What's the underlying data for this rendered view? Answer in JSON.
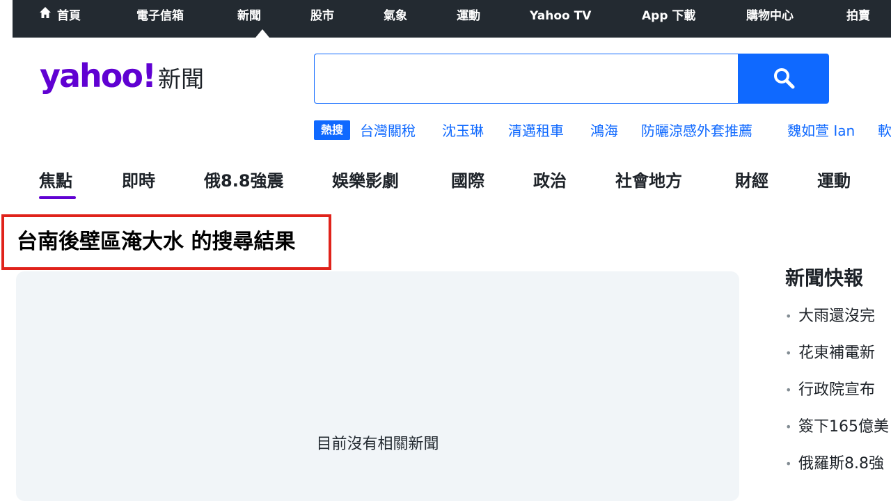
{
  "topnav": {
    "items": [
      {
        "label": "首頁",
        "icon": "home-icon"
      },
      {
        "label": "電子信箱"
      },
      {
        "label": "新聞",
        "active": true
      },
      {
        "label": "股市"
      },
      {
        "label": "氣象"
      },
      {
        "label": "運動"
      },
      {
        "label": "Yahoo TV"
      },
      {
        "label": "App 下載"
      },
      {
        "label": "購物中心"
      },
      {
        "label": "拍賣"
      }
    ]
  },
  "logo": {
    "brand": "yahoo!",
    "suffix": "新聞"
  },
  "search": {
    "value": "",
    "placeholder": "",
    "icon": "search-icon"
  },
  "trending": {
    "badge": "熱搜",
    "links": [
      "台灣關稅",
      "沈玉琳",
      "清邁租車",
      "鴻海",
      "防曬涼感外套推薦",
      "魏如萱 Ian",
      "軟"
    ]
  },
  "tabs": {
    "items": [
      "焦點",
      "即時",
      "俄8.8強震",
      "娛樂影劇",
      "國際",
      "政治",
      "社會地方",
      "財經",
      "運動"
    ],
    "active": "焦點"
  },
  "results": {
    "heading": "台南後壁區淹大水 的搜尋結果",
    "empty_message": "目前沒有相關新聞"
  },
  "sidebar": {
    "title": "新聞快報",
    "items": [
      "大雨還沒完",
      "花東補電新",
      "行政院宣布",
      "簽下165億美",
      "俄羅斯8.8強"
    ]
  },
  "colors": {
    "topbar_bg": "#232a31",
    "brand_purple": "#6001d2",
    "link_blue": "#0f69ff",
    "highlight_red": "#e0231b",
    "panel_bg": "#f1f5f8"
  }
}
